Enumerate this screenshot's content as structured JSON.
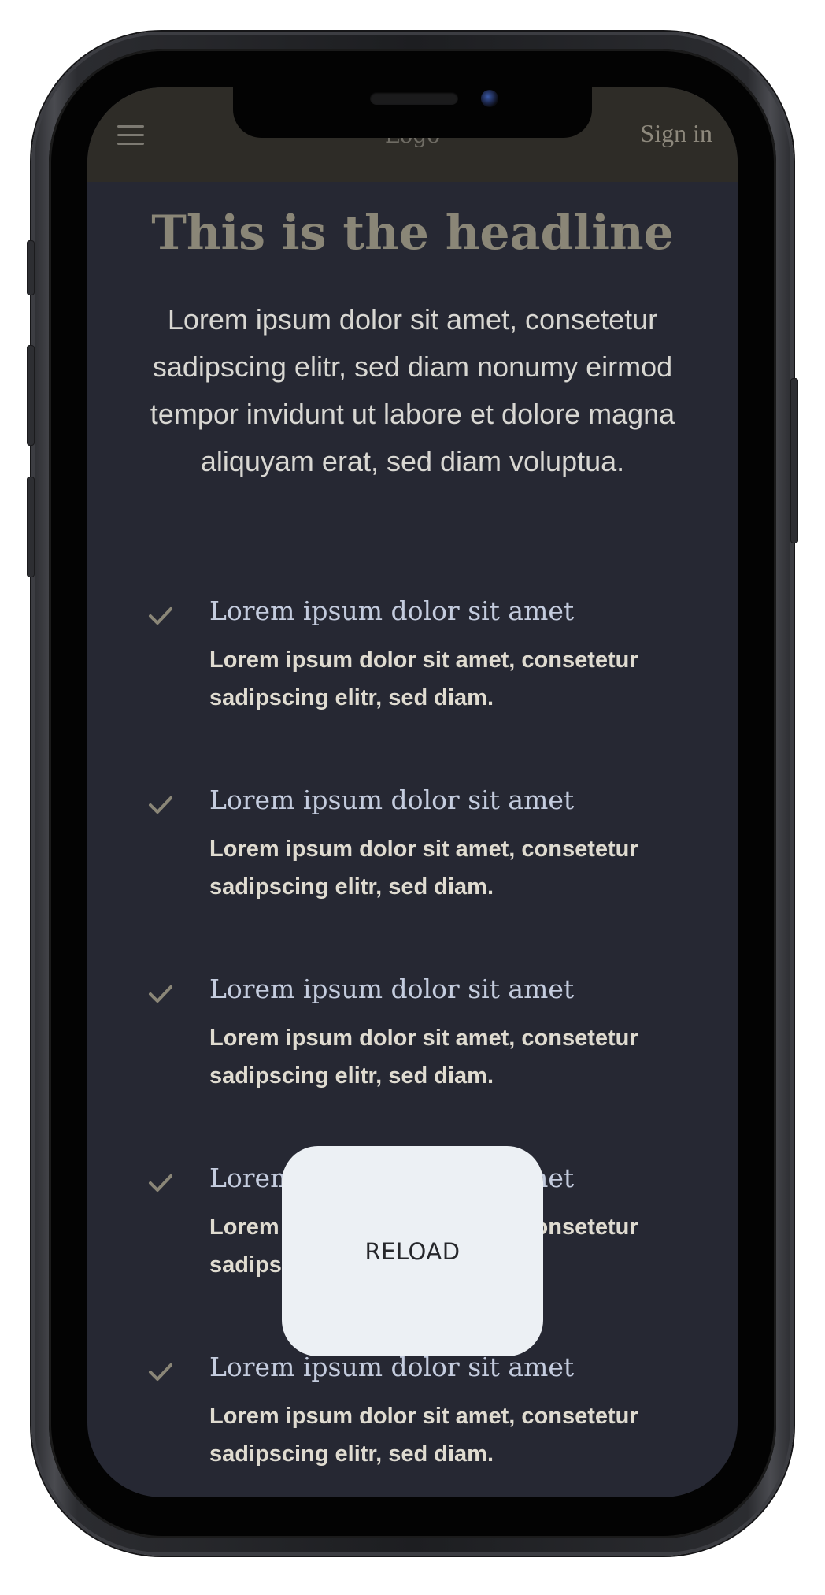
{
  "header": {
    "logo_text": "Logo",
    "signin_label": "Sign in",
    "menu_icon": "hamburger-menu-icon"
  },
  "hero": {
    "headline": "This is the headline",
    "lead": "Lorem ipsum dolor sit amet, consetetur sadipscing elitr, sed diam nonumy eirmod tempor invidunt ut labore et dolore magna aliquyam erat, sed diam voluptua."
  },
  "features": [
    {
      "title": "Lorem ipsum dolor sit amet",
      "description": "Lorem ipsum dolor sit amet, consetetur sadipscing elitr, sed diam.",
      "icon": "checkmark-icon"
    },
    {
      "title": "Lorem ipsum dolor sit amet",
      "description": "Lorem ipsum dolor sit amet, consetetur sadipscing elitr, sed diam.",
      "icon": "checkmark-icon"
    },
    {
      "title": "Lorem ipsum dolor sit amet",
      "description": "Lorem ipsum dolor sit amet, consetetur sadipscing elitr, sed diam.",
      "icon": "checkmark-icon"
    },
    {
      "title": "Lorem ipsum dolor sit amet",
      "description": "Lorem ipsum dolor sit amet, consetetur sadipscing elitr, sed diam.",
      "icon": "checkmark-icon"
    },
    {
      "title": "Lorem ipsum dolor sit amet",
      "description": "Lorem ipsum dolor sit amet, consetetur sadipscing elitr, sed diam.",
      "icon": "checkmark-icon"
    }
  ],
  "reload_button": {
    "label": "RELOAD"
  },
  "colors": {
    "screen_background": "#262833",
    "topbar_background": "#2e2c27",
    "headline": "#8a8677",
    "feature_title": "#c4ccde",
    "check": "#8a8677",
    "reload_background": "#ecf0f4"
  }
}
